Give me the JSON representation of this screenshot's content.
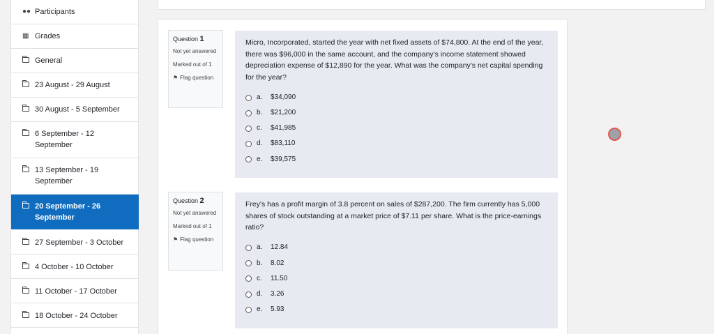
{
  "sidebar": {
    "items": [
      {
        "icon": "participants-icon",
        "label": "Participants",
        "active": false
      },
      {
        "icon": "grades-icon",
        "label": "Grades",
        "active": false
      },
      {
        "icon": "folder-icon",
        "label": "General",
        "active": false
      },
      {
        "icon": "folder-icon",
        "label": "23 August - 29 August",
        "active": false
      },
      {
        "icon": "folder-icon",
        "label": "30 August - 5 September",
        "active": false
      },
      {
        "icon": "folder-icon",
        "label": "6 September - 12 September",
        "active": false
      },
      {
        "icon": "folder-icon",
        "label": "13 September - 19 September",
        "active": false
      },
      {
        "icon": "folder-icon",
        "label": "20 September - 26 September",
        "active": true
      },
      {
        "icon": "folder-icon",
        "label": "27 September - 3 October",
        "active": false
      },
      {
        "icon": "folder-icon",
        "label": "4 October - 10 October",
        "active": false
      },
      {
        "icon": "folder-icon",
        "label": "11 October - 17 October",
        "active": false
      },
      {
        "icon": "folder-icon",
        "label": "18 October - 24 October",
        "active": false
      }
    ]
  },
  "questions": [
    {
      "label": "Question",
      "number": "1",
      "state": "Not yet answered",
      "marks": "Marked out of 1",
      "flag": "Flag question",
      "text": "Micro, Incorporated, started the year with net fixed assets of $74,800. At the end of the year, there was $96,000 in the same account, and the company's income statement showed depreciation expense of $12,890 for the year. What was the company's net capital spending for the year?",
      "options": [
        {
          "letter": "a.",
          "value": "$34,090"
        },
        {
          "letter": "b.",
          "value": "$21,200"
        },
        {
          "letter": "c.",
          "value": "$41,985"
        },
        {
          "letter": "d.",
          "value": "$83,110"
        },
        {
          "letter": "e.",
          "value": "$39,575"
        }
      ]
    },
    {
      "label": "Question",
      "number": "2",
      "state": "Not yet answered",
      "marks": "Marked out of 1",
      "flag": "Flag question",
      "text": "Frey's has a profit margin of 3.8 percent on sales of $287,200. The firm currently has 5,000 shares of stock outstanding at a market price of $7.11 per share. What is the price-earnings ratio?",
      "options": [
        {
          "letter": "a.",
          "value": "12.84"
        },
        {
          "letter": "b.",
          "value": "8.02"
        },
        {
          "letter": "c.",
          "value": "11.50"
        },
        {
          "letter": "d.",
          "value": "3.26"
        },
        {
          "letter": "e.",
          "value": "5.93"
        }
      ]
    }
  ],
  "colors": {
    "accent": "#0f6cbf",
    "question_bg": "#e7eaf0",
    "page_bg": "#f2f2f2"
  }
}
